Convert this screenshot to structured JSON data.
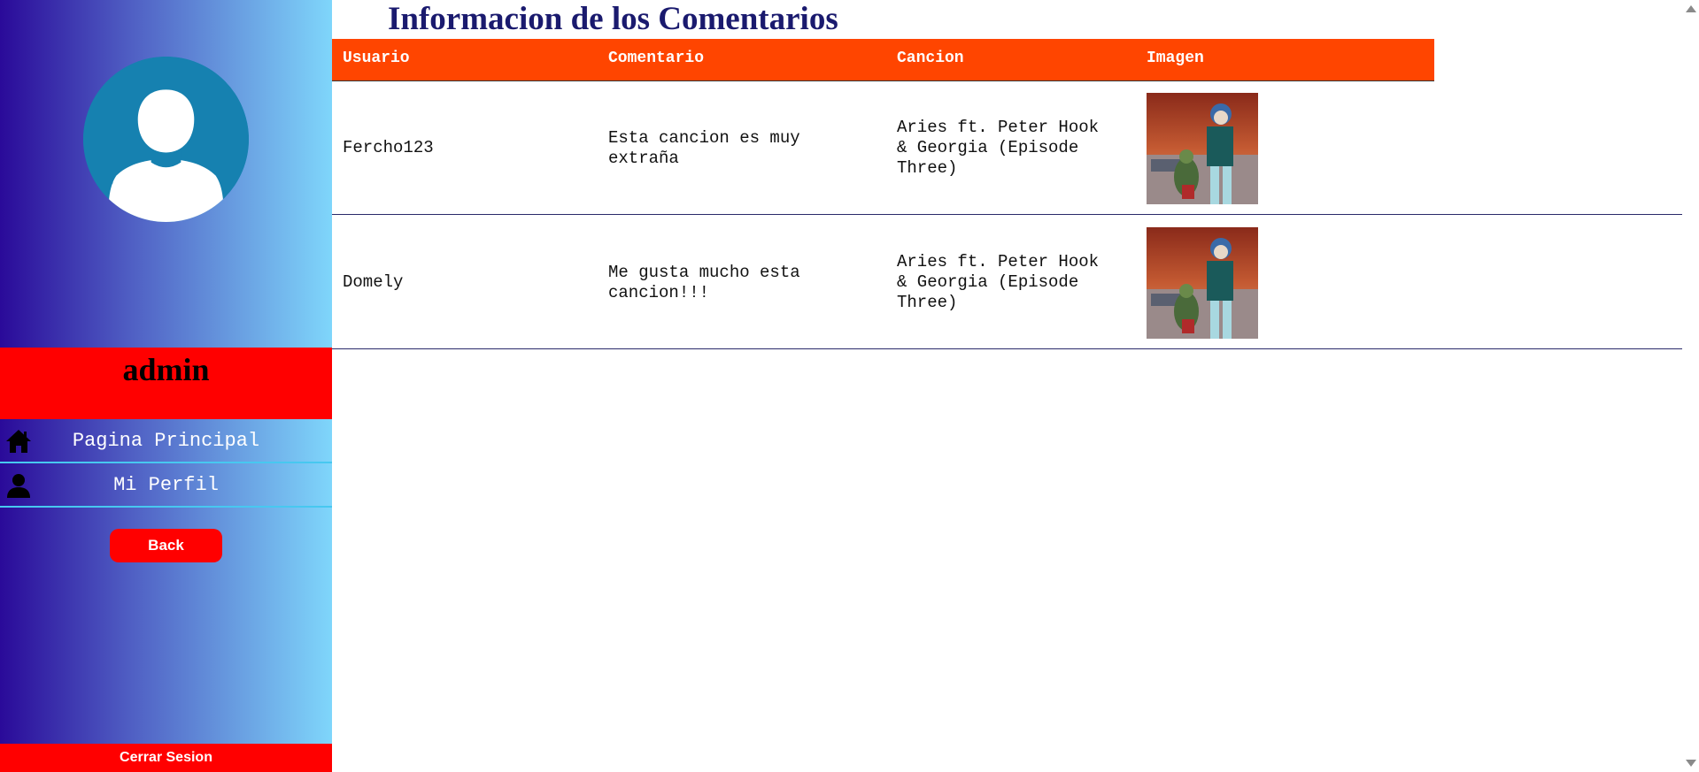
{
  "sidebar": {
    "username": "admin",
    "nav_items": [
      {
        "label": "Pagina Principal",
        "icon": "home-icon"
      },
      {
        "label": "Mi Perfil",
        "icon": "user-icon"
      }
    ],
    "back_label": "Back",
    "logout_label": "Cerrar Sesion"
  },
  "main": {
    "title": "Informacion de los Comentarios",
    "columns": [
      "Usuario",
      "Comentario",
      "Cancion",
      "Imagen"
    ],
    "rows": [
      {
        "usuario": "Fercho123",
        "comentario": [
          "Esta cancion es muy",
          "extraña"
        ],
        "cancion": [
          "Aries ft. Peter Hook",
          "& Georgia (Episode",
          "Three)"
        ]
      },
      {
        "usuario": "Domely",
        "comentario": [
          "Me gusta mucho esta",
          "cancion!!!"
        ],
        "cancion": [
          "Aries ft. Peter Hook",
          "& Georgia (Episode",
          "Three)"
        ]
      }
    ]
  },
  "colors": {
    "accent_red": "#ff0000",
    "header_orange": "#ff4500",
    "title_navy": "#1a1a6e",
    "sidebar_gradient_start": "#2a0a99",
    "sidebar_gradient_end": "#7fd6fb"
  }
}
